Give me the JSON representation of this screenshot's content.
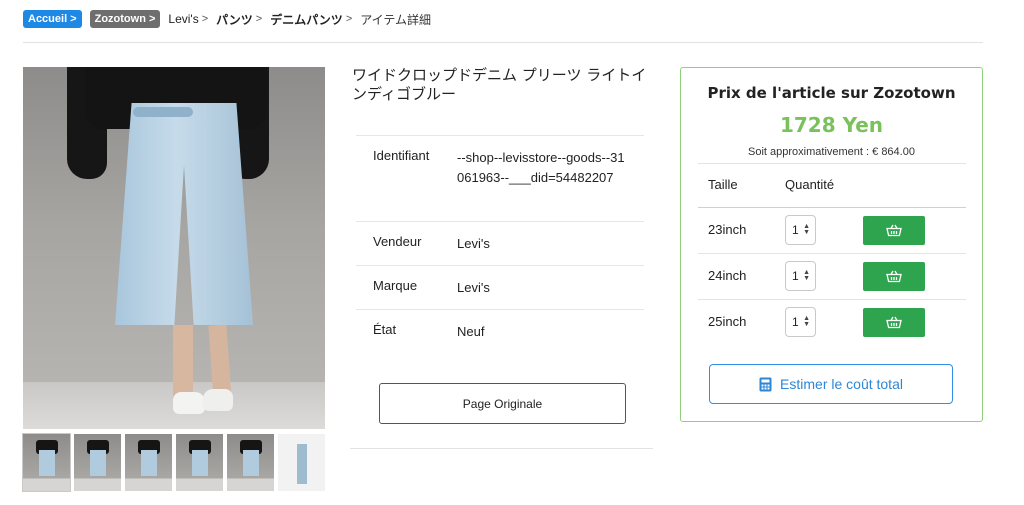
{
  "breadcrumb": {
    "home": "Accueil >",
    "store": "Zozotown >",
    "brand": "Levi's",
    "category": "パンツ",
    "subcategory": "デニムパンツ",
    "separator": ">",
    "current": "アイテム詳細"
  },
  "product": {
    "title": "ワイドクロップドデニム プリーツ ライトインディゴブルー",
    "thumbnail_count": 6,
    "details": [
      {
        "label": "Identifiant",
        "value": "--shop--levisstore--goods--31061963--___did=54482207"
      },
      {
        "label": "Vendeur",
        "value": "Levi's"
      },
      {
        "label": "Marque",
        "value": "Levi's"
      },
      {
        "label": "État",
        "value": "Neuf"
      }
    ],
    "original_button": "Page Originale"
  },
  "price_panel": {
    "title": "Prix de l'article sur Zozotown",
    "price": "1728 Yen",
    "approx": "Soit approximativement : € 864.00",
    "col_size": "Taille",
    "col_qty": "Quantité",
    "sizes": [
      {
        "size": "23inch",
        "qty": "1"
      },
      {
        "size": "24inch",
        "qty": "1"
      },
      {
        "size": "25inch",
        "qty": "1"
      }
    ],
    "estimate_button": "Estimer le coût total",
    "accent_color": "#7ac15c",
    "cart_color": "#2fa44f",
    "link_color": "#2d86d6"
  }
}
